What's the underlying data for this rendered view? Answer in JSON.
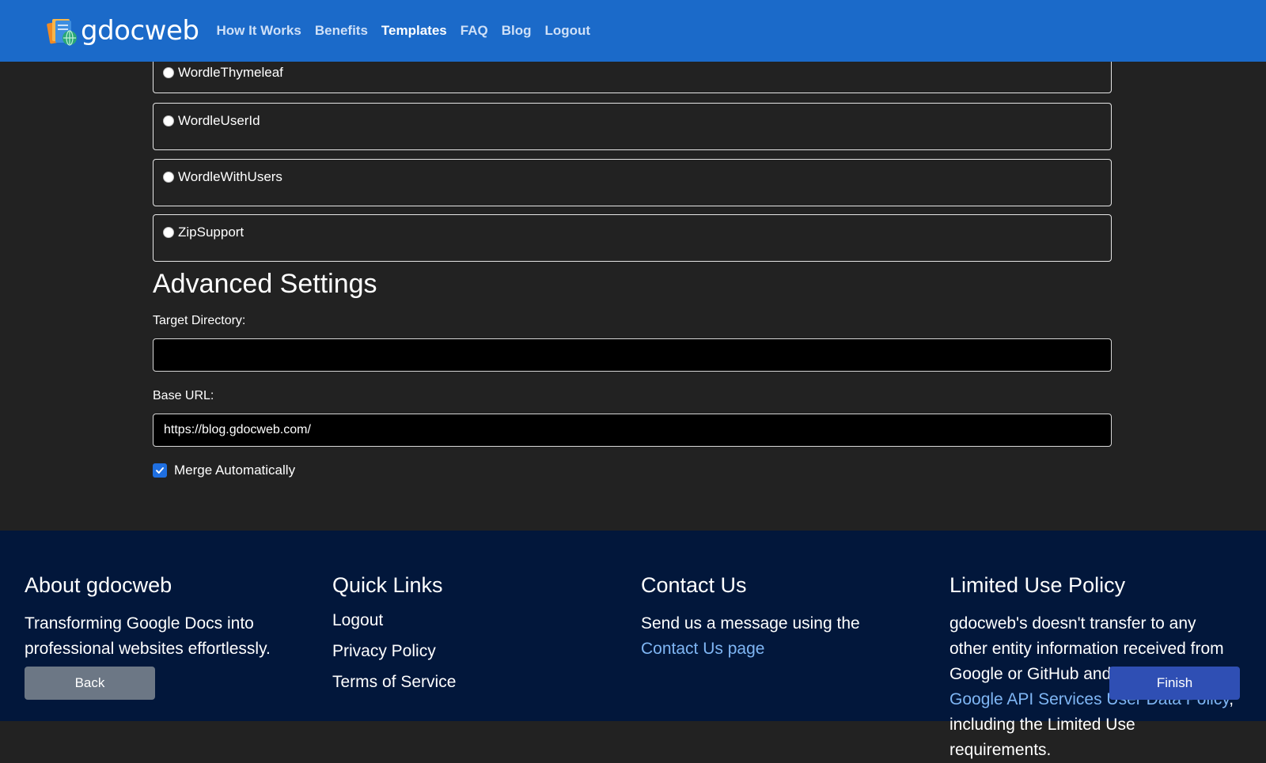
{
  "header": {
    "brand": "gdocweb",
    "nav": [
      {
        "label": "How It Works",
        "active": false
      },
      {
        "label": "Benefits",
        "active": false
      },
      {
        "label": "Templates",
        "active": true
      },
      {
        "label": "FAQ",
        "active": false
      },
      {
        "label": "Blog",
        "active": false
      },
      {
        "label": "Logout",
        "active": false
      }
    ]
  },
  "templates": [
    {
      "label": "WordleThymeleaf"
    },
    {
      "label": "WordleUserId"
    },
    {
      "label": "WordleWithUsers"
    },
    {
      "label": "ZipSupport"
    }
  ],
  "advanced": {
    "title": "Advanced Settings",
    "target_directory": {
      "label": "Target Directory:",
      "value": ""
    },
    "base_url": {
      "label": "Base URL:",
      "value": "https://blog.gdocweb.com/"
    },
    "merge": {
      "label": "Merge Automatically",
      "checked": true
    }
  },
  "footer": {
    "about": {
      "title": "About gdocweb",
      "text": "Transforming Google Docs into professional websites effortlessly."
    },
    "quick_links": {
      "title": "Quick Links",
      "items": [
        "Logout",
        "Privacy Policy",
        "Terms of Service"
      ]
    },
    "contact": {
      "title": "Contact Us",
      "text": "Send us a message using the",
      "link": "Contact Us page"
    },
    "policy": {
      "title": "Limited Use Policy",
      "text_1": "gdocweb's doesn't transfer to any other entity information received from Google or GitHub and adhere to",
      "link": "Google API Services User Data Policy",
      "text_2": ", including the Limited Use requirements."
    }
  },
  "buttons": {
    "back": "Back",
    "finish": "Finish"
  },
  "colors": {
    "header_bg": "#1b6ac9",
    "main_bg": "#222222",
    "footer_bg": "#02173b",
    "link": "#7fb6f4",
    "back_button": "#6c7785",
    "finish_button": "#2f4fb4",
    "checkbox": "#1f6fe0"
  }
}
